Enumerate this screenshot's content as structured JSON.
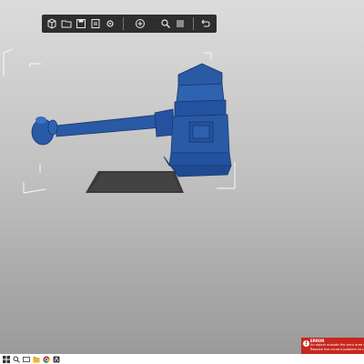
{
  "toolbar": {
    "buttons": [
      {
        "name": "box-button",
        "icon": "box-icon"
      },
      {
        "name": "open-button",
        "icon": "folder-icon"
      },
      {
        "name": "save-button",
        "icon": "save-icon"
      },
      {
        "name": "export-button",
        "icon": "export-icon"
      },
      {
        "name": "settings-button",
        "icon": "gear-icon"
      }
    ],
    "add_icon": "plus-icon",
    "right_buttons": [
      {
        "name": "search-button",
        "icon": "search-icon"
      },
      {
        "name": "layers-button",
        "icon": "layers-icon"
      },
      {
        "name": "undo-button",
        "icon": "undo-icon"
      }
    ]
  },
  "error_toast": {
    "title": "ERROR",
    "line1": "An object outside the print area was detected.",
    "line2": "Resolve the current problem to continue slicing."
  },
  "taskbar_icons": [
    "windows-icon",
    "search-icon",
    "taskview-icon",
    "explorer-icon",
    "chrome-icon",
    "app-icon"
  ],
  "colors": {
    "model": "#2a5aa4",
    "toolbar": "#2e2e2e",
    "error": "#c7271d",
    "bed": "#3a3a3a"
  }
}
